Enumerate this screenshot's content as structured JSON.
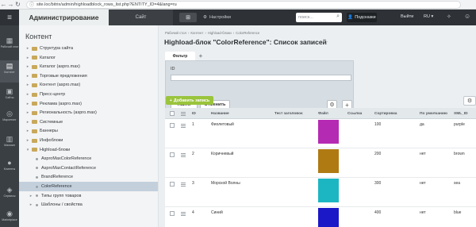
{
  "browser": {
    "back_icon": "arrow-left",
    "forward_icon": "arrow-right",
    "reload_icon": "reload",
    "url": "site.loc/bitrix/admin/highloadblock_rows_list.php?ENTITY_ID=4&lang=ru"
  },
  "topbar": {
    "admin_tab": "Администрирование",
    "site_tab": "Сайт",
    "settings_label": "Настройки",
    "search_placeholder": "поиск...",
    "notifications_label": "Подсказки",
    "logout_label": "Выйти",
    "lang_label": "RU"
  },
  "rail": [
    {
      "label": "Рабочий стол",
      "icon": "desktop-icon"
    },
    {
      "label": "Контент",
      "icon": "content-icon"
    },
    {
      "label": "Сайты",
      "icon": "sites-icon"
    },
    {
      "label": "Маркетинг",
      "icon": "marketing-icon"
    },
    {
      "label": "Магазин",
      "icon": "shop-icon"
    },
    {
      "label": "Клиенты",
      "icon": "clients-icon"
    },
    {
      "label": "Сервисы",
      "icon": "services-icon"
    },
    {
      "label": "Marketplace",
      "icon": "marketplace-icon"
    }
  ],
  "sidebar": {
    "title": "Контент",
    "items": [
      {
        "label": "Структура сайта",
        "kind": "folder",
        "expand": "▸"
      },
      {
        "label": "Каталог",
        "kind": "folder",
        "expand": "▸"
      },
      {
        "label": "Каталог (aspro.max)",
        "kind": "folder",
        "expand": "▸"
      },
      {
        "label": "Торговые предложения",
        "kind": "folder",
        "expand": "▸"
      },
      {
        "label": "Контент (aspro.max)",
        "kind": "folder",
        "expand": "▸"
      },
      {
        "label": "Пресс-центр",
        "kind": "folder",
        "expand": "▸"
      },
      {
        "label": "Реклама (aspro.max)",
        "kind": "folder",
        "expand": "▸"
      },
      {
        "label": "Региональность (aspro.max)",
        "kind": "folder",
        "expand": "▸"
      },
      {
        "label": "Системные",
        "kind": "folder",
        "expand": "▸"
      },
      {
        "label": "Баннеры",
        "kind": "folder",
        "expand": "▸"
      },
      {
        "label": "Инфоблоки",
        "kind": "folder",
        "expand": "▸"
      },
      {
        "label": "Highload-блоки",
        "kind": "folder",
        "expand": "▾"
      },
      {
        "label": "AsproMaxColorReference",
        "kind": "leaf",
        "expand": ""
      },
      {
        "label": "AsproMaxContactReference",
        "kind": "leaf",
        "expand": ""
      },
      {
        "label": "BrandReference",
        "kind": "leaf",
        "expand": ""
      },
      {
        "label": "ColorReference",
        "kind": "leaf",
        "expand": "",
        "selected": true
      },
      {
        "label": "Типы групп товаров",
        "kind": "leaf",
        "expand": "▸"
      },
      {
        "label": "Шаблоны / свойства",
        "kind": "leaf",
        "expand": "▸"
      }
    ]
  },
  "main": {
    "breadcrumb": [
      "Рабочий стол",
      "›",
      "Контент",
      "›",
      "Highload-блоки",
      "›",
      "ColorReference"
    ],
    "title": "Highload-блок \"ColorReference\": Список записей",
    "filter": {
      "tab_label": "Фильтр",
      "add_label": "+",
      "id_label": "ID",
      "id_value": "",
      "find_label": "Найти",
      "cancel_label": "Отменить"
    },
    "add_record_label": "Добавить запись",
    "table": {
      "columns": [
        "",
        "",
        "ID",
        "Название",
        "Тест заголовок",
        "Файл",
        "Ссылка",
        "Сортировка",
        "По умолчанию",
        "XML_ID"
      ],
      "rows": [
        {
          "id": "1",
          "name": "Фиолетовый",
          "test": "",
          "color": "#b52ab3",
          "link": "",
          "sort": "100",
          "default": "да",
          "xml_id": "purple"
        },
        {
          "id": "2",
          "name": "Коричневый",
          "test": "",
          "color": "#b07a12",
          "link": "",
          "sort": "200",
          "default": "нет",
          "xml_id": "brown"
        },
        {
          "id": "3",
          "name": "Морской Волны",
          "test": "",
          "color": "#1cb6c3",
          "link": "",
          "sort": "300",
          "default": "нет",
          "xml_id": "sea"
        },
        {
          "id": "4",
          "name": "Синий",
          "test": "",
          "color": "#1b18c7",
          "link": "",
          "sort": "400",
          "default": "нет",
          "xml_id": "blue"
        }
      ]
    }
  }
}
